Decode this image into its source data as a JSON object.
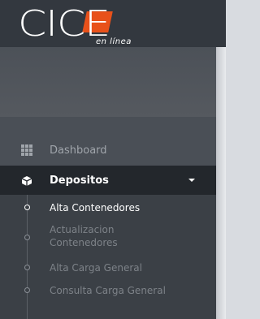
{
  "brand": {
    "name": "CICE",
    "tagline": "en línea"
  },
  "colors": {
    "header_bg": "#33383f",
    "sidebar_bg": "#4a4f56",
    "active_item_bg": "#23272c",
    "accent": "#e8511a"
  },
  "sidebar": {
    "items": [
      {
        "label": "Dashboard",
        "icon": "grid-icon",
        "active": false
      },
      {
        "label": "Depositos",
        "icon": "cube-icon",
        "active": true,
        "expanded": true
      }
    ],
    "submenu": [
      {
        "label": "Alta Contenedores",
        "active": true
      },
      {
        "label": "Actualizacion Contenedores",
        "active": false
      },
      {
        "label": "Alta Carga General",
        "active": false
      },
      {
        "label": "Consulta Carga General",
        "active": false
      }
    ]
  }
}
